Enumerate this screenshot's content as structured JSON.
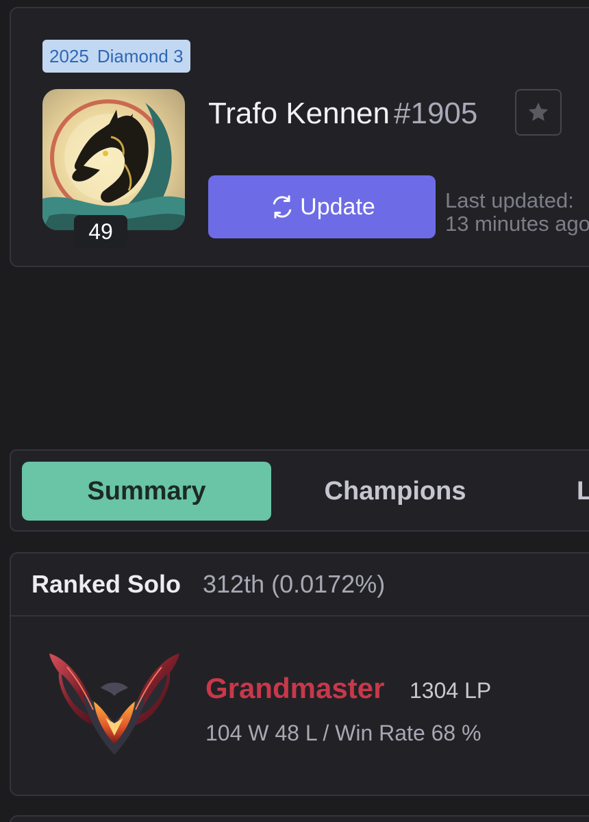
{
  "profile": {
    "season_year": "2025",
    "season_rank": "Diamond 3",
    "level": "49",
    "name": "Trafo Kennen",
    "tag": "#1905",
    "favorite_icon": "star-icon",
    "update_label": "Update",
    "update_icon": "refresh-icon",
    "last_updated_line1": "Last updated:",
    "last_updated_line2": "13 minutes ago"
  },
  "tabs": [
    {
      "label": "Summary",
      "active": true
    },
    {
      "label": "Champions",
      "active": false
    },
    {
      "label": "L",
      "active": false
    }
  ],
  "ranked": {
    "title": "Ranked Solo",
    "position": "312th (0.0172%)",
    "tier": "Grandmaster",
    "lp": "1304 LP",
    "record": "104 W 48 L / Win Rate 68 %",
    "tier_color": "#c8384a"
  },
  "colors": {
    "background": "#1c1c1f",
    "card": "#222226",
    "accent_update": "#6d6ce6",
    "accent_tab": "#6ac4a6",
    "season_badge_bg": "#c2d8f2",
    "season_badge_text": "#2e67b6"
  }
}
